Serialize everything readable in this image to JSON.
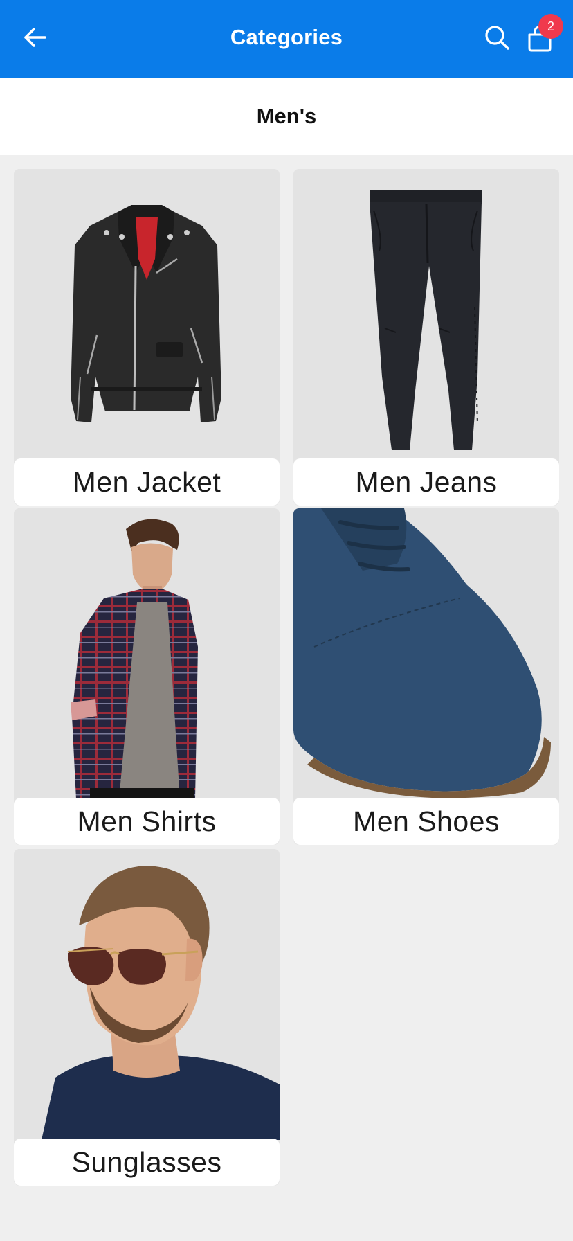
{
  "app_bar": {
    "title": "Categories",
    "back_icon": "arrow-left-icon",
    "search_icon": "search-icon",
    "cart_icon": "shopping-bag-icon",
    "cart_count": "2",
    "background": "#0a7ce9",
    "badge_color": "#f0394d"
  },
  "section": {
    "title": "Men's"
  },
  "categories": [
    {
      "label": "Men Jacket",
      "image": "black-leather-jacket"
    },
    {
      "label": "Men Jeans",
      "image": "black-trousers"
    },
    {
      "label": "Men Shirts",
      "image": "man-in-plaid-shirt"
    },
    {
      "label": "Men Shoes",
      "image": "blue-suede-shoe"
    },
    {
      "label": "Sunglasses",
      "image": "man-with-aviator-sunglasses"
    }
  ]
}
